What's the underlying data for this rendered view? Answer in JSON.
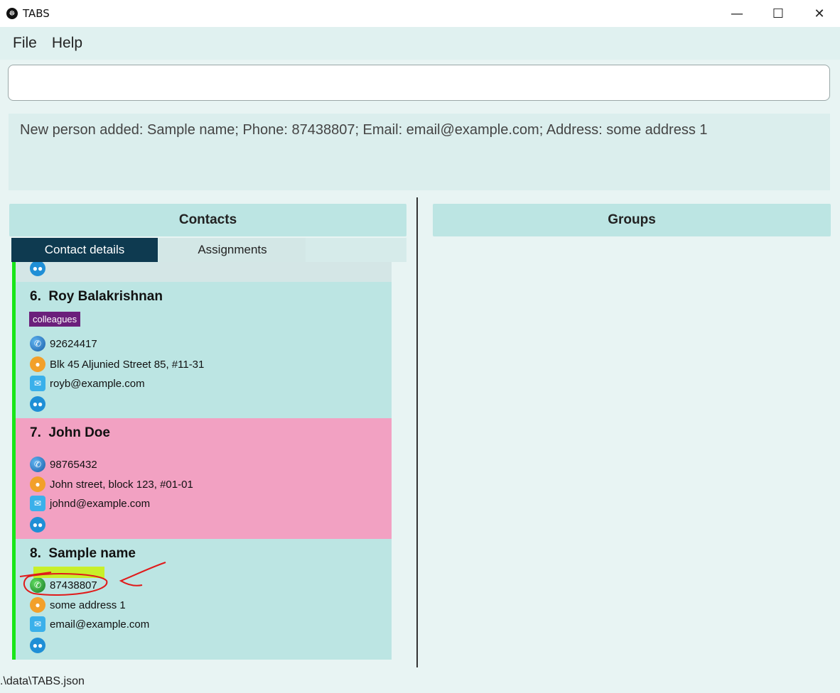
{
  "window": {
    "title": "TABS",
    "minimize": "—",
    "maximize": "☐",
    "close": "✕"
  },
  "menu": {
    "file": "File",
    "help": "Help"
  },
  "command": {
    "value": ""
  },
  "result": {
    "text": "New person added: Sample name; Phone: 87438807; Email: email@example.com; Address: some address 1"
  },
  "contacts": {
    "header": "Contacts",
    "tabs": [
      "Contact details",
      "Assignments"
    ],
    "cards": [
      {
        "index": "6.",
        "name": "Roy Balakrishnan",
        "tag": "colleagues",
        "phone": "92624417",
        "address": "Blk 45 Aljunied Street 85, #11-31",
        "email": "royb@example.com"
      },
      {
        "index": "7.",
        "name": "John Doe",
        "tag": "",
        "phone": "98765432",
        "address": "John street, block 123, #01-01",
        "email": "johnd@example.com"
      },
      {
        "index": "8.",
        "name": "Sample name",
        "tag": "",
        "phone": "87438807",
        "address": "some address 1",
        "email": "email@example.com"
      }
    ]
  },
  "groups": {
    "header": "Groups"
  },
  "status": {
    "path": ".\\data\\TABS.json"
  },
  "colors": {
    "selected_card": "#f2a1c2",
    "card": "#bce5e3",
    "accent_bar": "#19e619",
    "tag": "#6b1f7b",
    "active_tab": "#0e3a50"
  },
  "icons": [
    "phone-icon",
    "location-icon",
    "email-icon",
    "group-icon"
  ]
}
